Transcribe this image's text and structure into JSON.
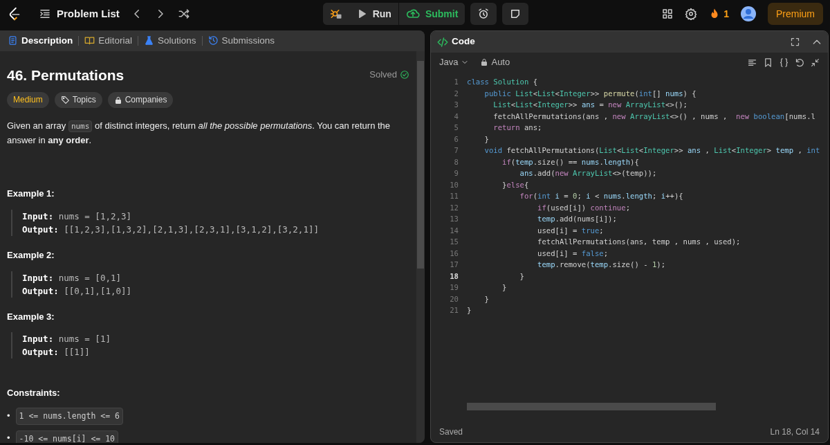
{
  "nav": {
    "problem_list": "Problem List",
    "run": "Run",
    "submit": "Submit",
    "streak": "1",
    "premium": "Premium"
  },
  "left_tabs": [
    {
      "label": "Description",
      "kind": "description",
      "selected": true
    },
    {
      "label": "Editorial",
      "kind": "editorial",
      "selected": false
    },
    {
      "label": "Solutions",
      "kind": "solutions",
      "selected": false
    },
    {
      "label": "Submissions",
      "kind": "submissions",
      "selected": false
    }
  ],
  "problem": {
    "title": "46. Permutations",
    "status": "Solved",
    "tags": [
      {
        "label": "Medium",
        "kind": "difficulty"
      },
      {
        "label": "Topics",
        "kind": "topics"
      },
      {
        "label": "Companies",
        "kind": "companies"
      }
    ],
    "description": [
      {
        "kind": "text",
        "text": "Given an array "
      },
      {
        "kind": "code",
        "text": "nums"
      },
      {
        "kind": "text",
        "text": " of distinct integers, return *all the possible permutations*. You can return the answer in **any order**."
      }
    ],
    "examples": [
      {
        "heading": "Example 1:",
        "lines": [
          {
            "label": "Input:",
            "value": "nums = [1,2,3]"
          },
          {
            "label": "Output:",
            "value": "[[1,2,3],[1,3,2],[2,1,3],[2,3,1],[3,1,2],[3,2,1]]"
          }
        ]
      },
      {
        "heading": "Example 2:",
        "lines": [
          {
            "label": "Input:",
            "value": "nums = [0,1]"
          },
          {
            "label": "Output:",
            "value": "[[0,1],[1,0]]"
          }
        ]
      },
      {
        "heading": "Example 3:",
        "lines": [
          {
            "label": "Input:",
            "value": "nums = [1]"
          },
          {
            "label": "Output:",
            "value": "[[1]]"
          }
        ]
      }
    ],
    "constraints_heading": "Constraints:",
    "constraints": [
      {
        "marker": "•",
        "text": "1 <= nums.length <= 6"
      },
      {
        "marker": "•",
        "text": "-10 <= nums[i] <= 10"
      }
    ]
  },
  "editor": {
    "title": "Code",
    "language": "Java",
    "mode": "Auto",
    "status": "Saved",
    "cursor": "Ln 18, Col 14",
    "lines": [
      {
        "number": "1",
        "current": false,
        "tokens": [
          {
            "kind": "storage",
            "text": "class"
          },
          {
            "kind": "type",
            "text": " Solution"
          },
          {
            "kind": "plain",
            "text": " {"
          }
        ]
      },
      {
        "number": "2",
        "current": false,
        "tokens": [
          {
            "kind": "storage",
            "text": "    public"
          },
          {
            "kind": "type",
            "text": " List"
          },
          {
            "kind": "plain",
            "text": "<"
          },
          {
            "kind": "type",
            "text": "List"
          },
          {
            "kind": "plain",
            "text": "<"
          },
          {
            "kind": "type",
            "text": "Integer"
          },
          {
            "kind": "plain",
            "text": ">> "
          },
          {
            "kind": "func",
            "text": "permute"
          },
          {
            "kind": "plain",
            "text": "("
          },
          {
            "kind": "storage",
            "text": "int"
          },
          {
            "kind": "plain",
            "text": "[] "
          },
          {
            "kind": "var",
            "text": "nums"
          },
          {
            "kind": "plain",
            "text": ") {"
          }
        ]
      },
      {
        "number": "3",
        "current": false,
        "tokens": [
          {
            "kind": "type",
            "text": "      List"
          },
          {
            "kind": "plain",
            "text": "<"
          },
          {
            "kind": "type",
            "text": "List"
          },
          {
            "kind": "plain",
            "text": "<"
          },
          {
            "kind": "type",
            "text": "Integer"
          },
          {
            "kind": "plain",
            "text": ">> "
          },
          {
            "kind": "var",
            "text": "ans"
          },
          {
            "kind": "plain",
            "text": " = "
          },
          {
            "kind": "control",
            "text": "new"
          },
          {
            "kind": "type",
            "text": " ArrayList"
          },
          {
            "kind": "plain",
            "text": "<>();"
          }
        ]
      },
      {
        "number": "4",
        "current": false,
        "tokens": [
          {
            "kind": "plain",
            "text": "      fetchAllPermutations(ans , "
          },
          {
            "kind": "control",
            "text": "new"
          },
          {
            "kind": "type",
            "text": " ArrayList"
          },
          {
            "kind": "plain",
            "text": "<>() , nums ,  "
          },
          {
            "kind": "control",
            "text": "new"
          },
          {
            "kind": "storage",
            "text": " boolean"
          },
          {
            "kind": "plain",
            "text": "[nums.l"
          }
        ]
      },
      {
        "number": "5",
        "current": false,
        "tokens": [
          {
            "kind": "control",
            "text": "      return"
          },
          {
            "kind": "plain",
            "text": " ans;"
          }
        ]
      },
      {
        "number": "6",
        "current": false,
        "tokens": [
          {
            "kind": "plain",
            "text": "    }"
          }
        ]
      },
      {
        "number": "7",
        "current": false,
        "tokens": [
          {
            "kind": "storage",
            "text": "    void"
          },
          {
            "kind": "plain",
            "text": " fetchAllPermutations("
          },
          {
            "kind": "type",
            "text": "List"
          },
          {
            "kind": "plain",
            "text": "<"
          },
          {
            "kind": "type",
            "text": "List"
          },
          {
            "kind": "plain",
            "text": "<"
          },
          {
            "kind": "type",
            "text": "Integer"
          },
          {
            "kind": "plain",
            "text": ">> "
          },
          {
            "kind": "var",
            "text": "ans"
          },
          {
            "kind": "plain",
            "text": " , "
          },
          {
            "kind": "type",
            "text": "List"
          },
          {
            "kind": "plain",
            "text": "<"
          },
          {
            "kind": "type",
            "text": "Integer"
          },
          {
            "kind": "plain",
            "text": "> "
          },
          {
            "kind": "var",
            "text": "temp"
          },
          {
            "kind": "plain",
            "text": " , "
          },
          {
            "kind": "storage",
            "text": "int"
          }
        ]
      },
      {
        "number": "8",
        "current": false,
        "tokens": [
          {
            "kind": "control",
            "text": "        if"
          },
          {
            "kind": "plain",
            "text": "("
          },
          {
            "kind": "var",
            "text": "temp"
          },
          {
            "kind": "plain",
            "text": ".size() == "
          },
          {
            "kind": "var",
            "text": "nums"
          },
          {
            "kind": "plain",
            "text": "."
          },
          {
            "kind": "var",
            "text": "length"
          },
          {
            "kind": "plain",
            "text": "){"
          }
        ]
      },
      {
        "number": "9",
        "current": false,
        "tokens": [
          {
            "kind": "var",
            "text": "            ans"
          },
          {
            "kind": "plain",
            "text": ".add("
          },
          {
            "kind": "control",
            "text": "new"
          },
          {
            "kind": "type",
            "text": " ArrayList"
          },
          {
            "kind": "plain",
            "text": "<>(temp));"
          }
        ]
      },
      {
        "number": "10",
        "current": false,
        "tokens": [
          {
            "kind": "plain",
            "text": "        }"
          },
          {
            "kind": "control",
            "text": "else"
          },
          {
            "kind": "plain",
            "text": "{"
          }
        ]
      },
      {
        "number": "11",
        "current": false,
        "tokens": [
          {
            "kind": "control",
            "text": "            for"
          },
          {
            "kind": "plain",
            "text": "("
          },
          {
            "kind": "storage",
            "text": "int"
          },
          {
            "kind": "var",
            "text": " i"
          },
          {
            "kind": "plain",
            "text": " = "
          },
          {
            "kind": "number",
            "text": "0"
          },
          {
            "kind": "plain",
            "text": "; "
          },
          {
            "kind": "var",
            "text": "i"
          },
          {
            "kind": "plain",
            "text": " < "
          },
          {
            "kind": "var",
            "text": "nums"
          },
          {
            "kind": "plain",
            "text": "."
          },
          {
            "kind": "var",
            "text": "length"
          },
          {
            "kind": "plain",
            "text": "; "
          },
          {
            "kind": "var",
            "text": "i"
          },
          {
            "kind": "plain",
            "text": "++){"
          }
        ]
      },
      {
        "number": "12",
        "current": false,
        "tokens": [
          {
            "kind": "control",
            "text": "                if"
          },
          {
            "kind": "plain",
            "text": "(used[i]) "
          },
          {
            "kind": "control",
            "text": "continue"
          },
          {
            "kind": "plain",
            "text": ";"
          }
        ]
      },
      {
        "number": "13",
        "current": false,
        "tokens": [
          {
            "kind": "var",
            "text": "                temp"
          },
          {
            "kind": "plain",
            "text": ".add(nums[i]);"
          }
        ]
      },
      {
        "number": "14",
        "current": false,
        "tokens": [
          {
            "kind": "plain",
            "text": "                used[i] = "
          },
          {
            "kind": "storage",
            "text": "true"
          },
          {
            "kind": "plain",
            "text": ";"
          }
        ]
      },
      {
        "number": "15",
        "current": false,
        "tokens": [
          {
            "kind": "plain",
            "text": "                fetchAllPermutations(ans, temp , nums , used);"
          }
        ]
      },
      {
        "number": "16",
        "current": false,
        "tokens": [
          {
            "kind": "plain",
            "text": "                used[i] = "
          },
          {
            "kind": "storage",
            "text": "false"
          },
          {
            "kind": "plain",
            "text": ";"
          }
        ]
      },
      {
        "number": "17",
        "current": false,
        "tokens": [
          {
            "kind": "var",
            "text": "                temp"
          },
          {
            "kind": "plain",
            "text": ".remove("
          },
          {
            "kind": "var",
            "text": "temp"
          },
          {
            "kind": "plain",
            "text": ".size() - "
          },
          {
            "kind": "number",
            "text": "1"
          },
          {
            "kind": "plain",
            "text": ");"
          }
        ]
      },
      {
        "number": "18",
        "current": true,
        "tokens": [
          {
            "kind": "plain",
            "text": "            }"
          }
        ]
      },
      {
        "number": "19",
        "current": false,
        "tokens": [
          {
            "kind": "plain",
            "text": "        }"
          }
        ]
      },
      {
        "number": "20",
        "current": false,
        "tokens": [
          {
            "kind": "plain",
            "text": "    }"
          }
        ]
      },
      {
        "number": "21",
        "current": false,
        "tokens": [
          {
            "kind": "plain",
            "text": "}"
          }
        ]
      }
    ]
  }
}
